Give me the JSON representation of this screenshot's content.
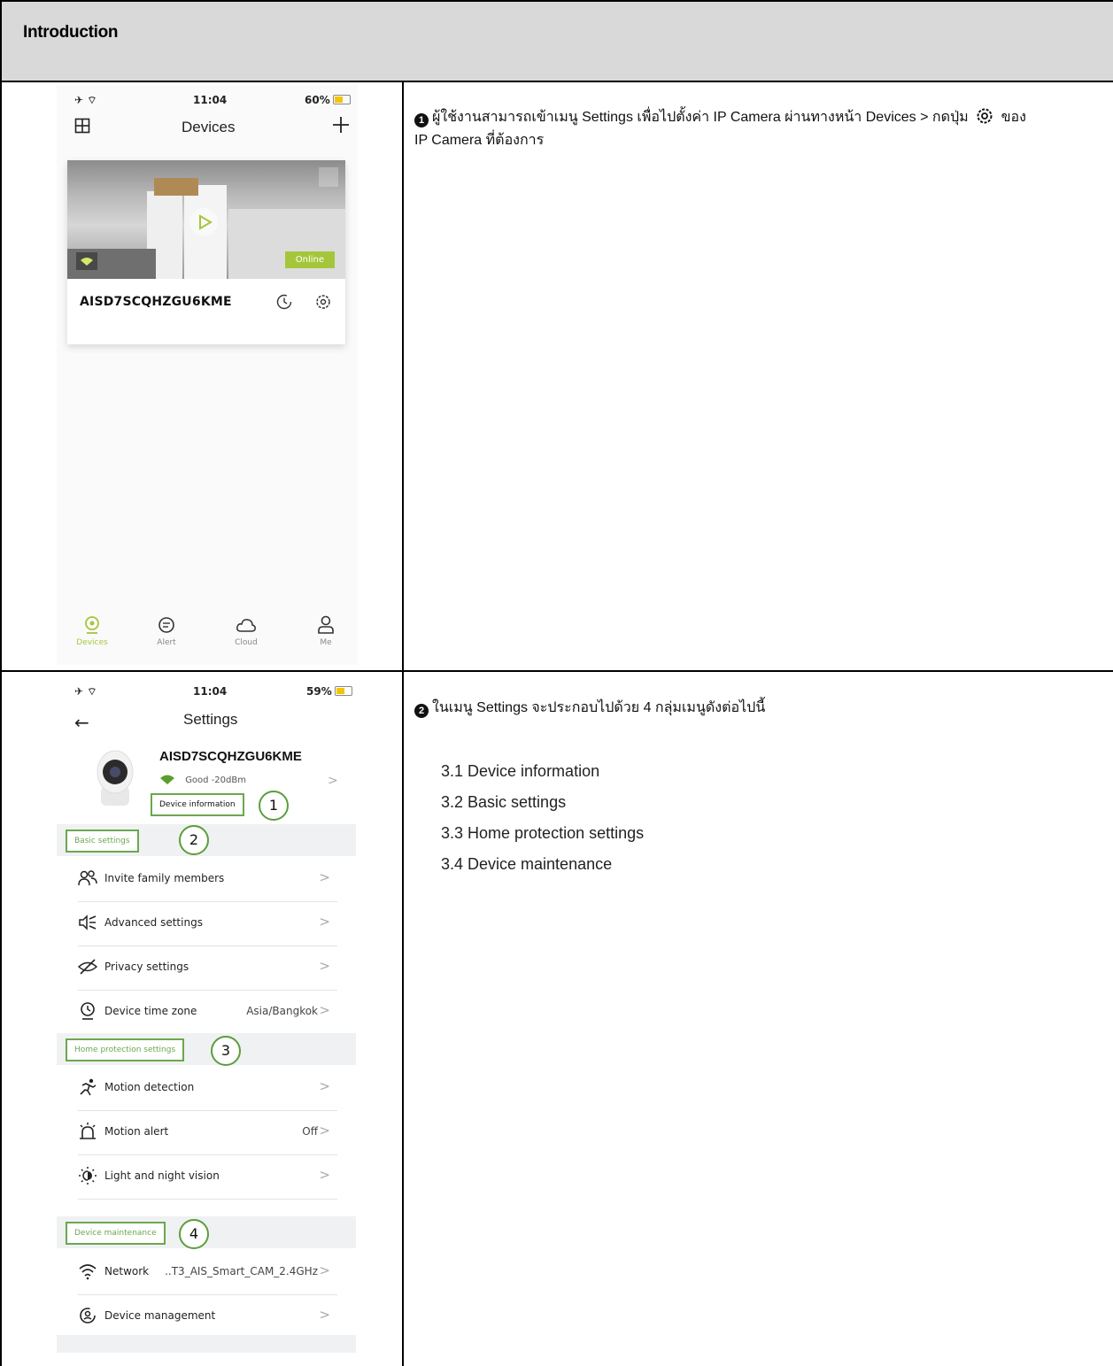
{
  "header": {
    "title": "Introduction"
  },
  "step1": {
    "text_prefix": "ผู้ใช้งานสามารถเข้าเมนู Settings เพื่อไปตั้งค่า IP Camera ผ่านทางหน้า Devices > กดปุ่ม",
    "text_suffix": "ของ",
    "text_line2": "IP Camera ที่ต้องการ",
    "number": "1",
    "gear_icon": "gear-icon"
  },
  "step2": {
    "text": "ในเมนู Settings จะประกอบไปด้วย 4 กลุ่มเมนูดังต่อไปนี้",
    "number": "2",
    "items": [
      "3.1 Device information",
      "3.2 Basic settings",
      "3.3 Home protection settings",
      "3.4 Device maintenance"
    ]
  },
  "phone1": {
    "time": "11:04",
    "battery": "60%",
    "battery_level": 0.6,
    "title": "Devices",
    "device_name": "AISD7SCQHZGU6KME",
    "status": "Online",
    "tabs": [
      {
        "label": "Devices",
        "icon": "camera-icon",
        "active": true
      },
      {
        "label": "Alert",
        "icon": "message-icon",
        "active": false
      },
      {
        "label": "Cloud",
        "icon": "cloud-icon",
        "active": false
      },
      {
        "label": "Me",
        "icon": "person-icon",
        "active": false
      }
    ],
    "accent": "#a5c63b"
  },
  "phone2": {
    "time": "11:04",
    "battery": "59%",
    "battery_level": 0.59,
    "title": "Settings",
    "device_name": "AISD7SCQHZGU6KME",
    "signal": "Good -20dBm",
    "callouts": {
      "device_information": "Device information",
      "basic_settings": "Basic settings",
      "home_protection": "Home protection settings",
      "device_maintenance": "Device maintenance",
      "n1": "1",
      "n2": "2",
      "n3": "3",
      "n4": "4"
    },
    "rows": {
      "invite": "Invite family members",
      "advanced": "Advanced settings",
      "privacy": "Privacy settings",
      "timezone": "Device time zone",
      "timezone_value": "Asia/Bangkok",
      "motion_detection": "Motion detection",
      "motion_alert": "Motion alert",
      "motion_alert_value": "Off",
      "light": "Light and night vision",
      "network": "Network",
      "network_value": "..T3_AIS_Smart_CAM_2.4GHz",
      "management": "Device management"
    },
    "chevron": ">"
  }
}
